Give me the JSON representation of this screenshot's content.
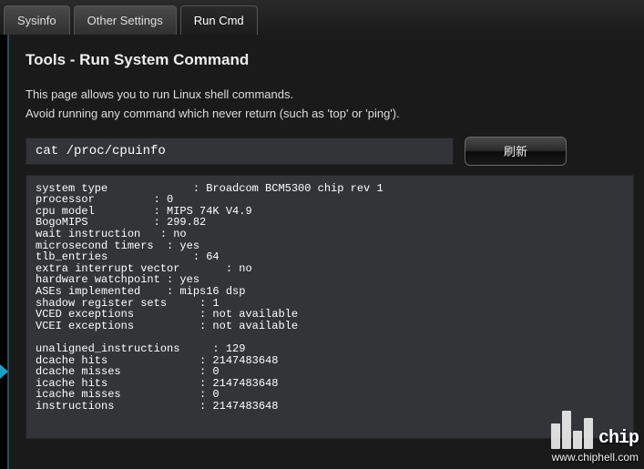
{
  "tabs": {
    "sysinfo": "Sysinfo",
    "other": "Other Settings",
    "runcmd": "Run Cmd"
  },
  "page": {
    "title": "Tools - Run System Command",
    "desc1": "This page allows you to run Linux shell commands.",
    "desc2": "Avoid running any command which never return (such as 'top' or 'ping')."
  },
  "cmd": {
    "value": "cat /proc/cpuinfo",
    "refresh": "刷新"
  },
  "output_lines": [
    "system type             : Broadcom BCM5300 chip rev 1",
    "processor         : 0",
    "cpu model         : MIPS 74K V4.9",
    "BogoMIPS          : 299.82",
    "wait instruction   : no",
    "microsecond timers  : yes",
    "tlb_entries             : 64",
    "extra interrupt vector       : no",
    "hardware watchpoint : yes",
    "ASEs implemented    : mips16 dsp",
    "shadow register sets     : 1",
    "VCED exceptions          : not available",
    "VCEI exceptions          : not available",
    "",
    "unaligned_instructions     : 129",
    "dcache hits              : 2147483648",
    "dcache misses            : 0",
    "icache hits              : 2147483648",
    "icache misses            : 0",
    "instructions             : 2147483648"
  ],
  "watermark": {
    "logo": "chip",
    "url": "www.chiphell.com"
  }
}
